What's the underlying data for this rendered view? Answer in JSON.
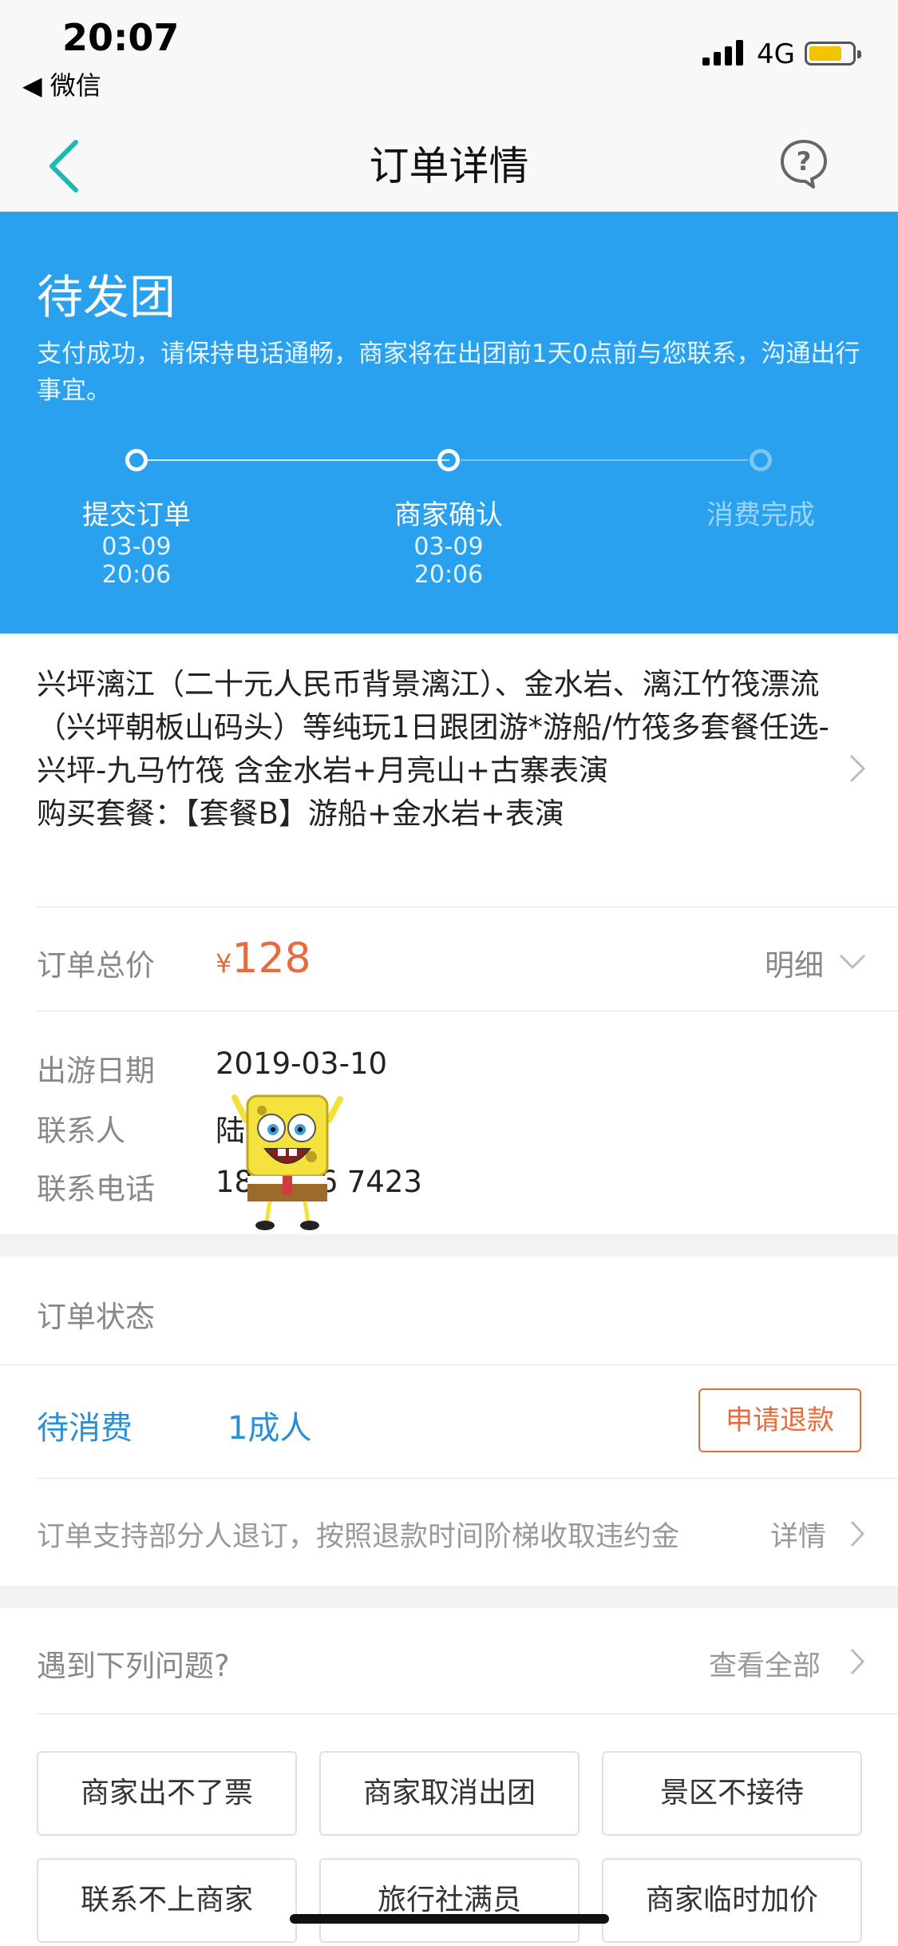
{
  "status_bar": {
    "time": "20:07",
    "back_app": "◀ 微信",
    "network": "4G",
    "battery_color": "#f2c400"
  },
  "nav": {
    "title": "订单详情",
    "back_icon": "chevron-left-icon",
    "help_icon": "question-bubble-icon",
    "accent": "#1dbab5"
  },
  "hero": {
    "title": "待发团",
    "description": "支付成功，请保持电话通畅，商家将在出团前1天0点前与您联系，沟通出行事宜。",
    "background": "#29a1ee",
    "steps": [
      {
        "label": "提交订单",
        "date": "03-09",
        "time": "20:06"
      },
      {
        "label": "商家确认",
        "date": "03-09",
        "time": "20:06"
      },
      {
        "label": "消费完成"
      }
    ]
  },
  "product": {
    "name": "兴坪漓江（二十元人民币背景漓江）、金水岩、漓江竹筏漂流（兴坪朝板山码头）等纯玩1日跟团游*游船/竹筏多套餐任选-兴坪-九马竹筏 含金水岩+月亮山+古寨表演",
    "package": "购买套餐：【套餐B】游船+金水岩+表演"
  },
  "price": {
    "label": "订单总价",
    "currency": "¥",
    "amount": "128",
    "detail": "明细",
    "color": "#e96b3b"
  },
  "info": {
    "date_label": "出游日期",
    "date_value": "2019-03-10",
    "contact_label": "联系人",
    "contact_value": "陆",
    "phone_label": "联系电话",
    "phone_value": "180 886 7423"
  },
  "order_status": {
    "header": "订单状态",
    "status": "待消费",
    "count": "1成人",
    "refund_button": "申请退款",
    "note": "订单支持部分人退订，按照退款时间阶梯收取违约金",
    "note_link": "详情",
    "accent": "#2b8fd6"
  },
  "problems": {
    "header": "遇到下列问题?",
    "view_all": "查看全部",
    "buttons": [
      "商家出不了票",
      "商家取消出团",
      "景区不接待",
      "联系不上商家",
      "旅行社满员",
      "商家临时加价"
    ]
  }
}
